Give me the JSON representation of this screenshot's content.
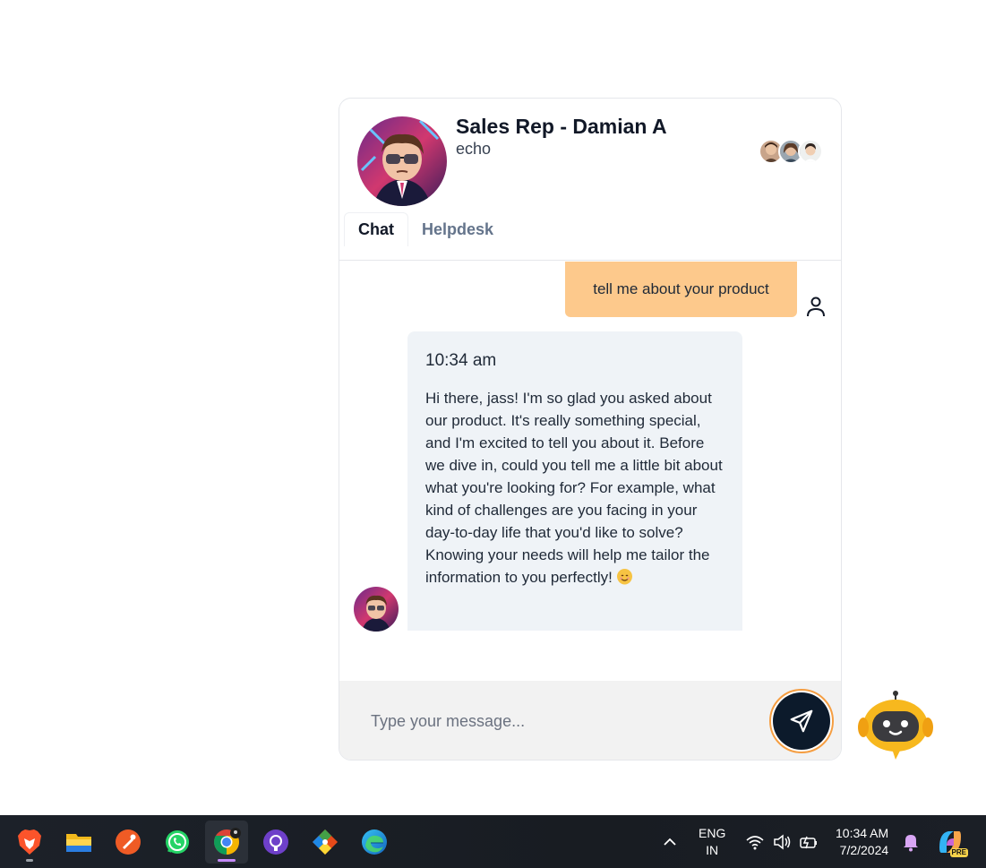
{
  "chat": {
    "title": "Sales Rep - Damian A",
    "subtitle": "echo",
    "tabs": [
      {
        "label": "Chat",
        "active": true
      },
      {
        "label": "Helpdesk",
        "active": false
      }
    ],
    "messages": {
      "user": {
        "text": "tell me about your product"
      },
      "bot": {
        "time": "10:34 am",
        "text": "Hi there, jass! I'm so glad you asked about our product. It's really something special, and I'm excited to tell you about it. Before we dive in, could you tell me a little bit about what you're looking for? For example, what kind of challenges are you facing in your day-to-day life that you'd like to solve? Knowing your needs will help me tailor the information to you perfectly!"
      }
    },
    "input": {
      "placeholder": "Type your message...",
      "value": ""
    },
    "colors": {
      "user_bubble": "#fdc98c",
      "bot_bubble": "#eff3f7",
      "send_button": "#0c1a2b",
      "send_ring": "#f59e42"
    }
  },
  "taskbar": {
    "apps": [
      "brave-icon",
      "file-explorer-icon",
      "postman-icon",
      "whatsapp-icon",
      "chrome-icon",
      "github-desktop-icon",
      "git-icon",
      "edge-icon"
    ],
    "active_app": "chrome-icon",
    "language": {
      "line1": "ENG",
      "line2": "IN"
    },
    "time": "10:34 AM",
    "date": "7/2/2024",
    "copilot_badge": "PRE"
  }
}
